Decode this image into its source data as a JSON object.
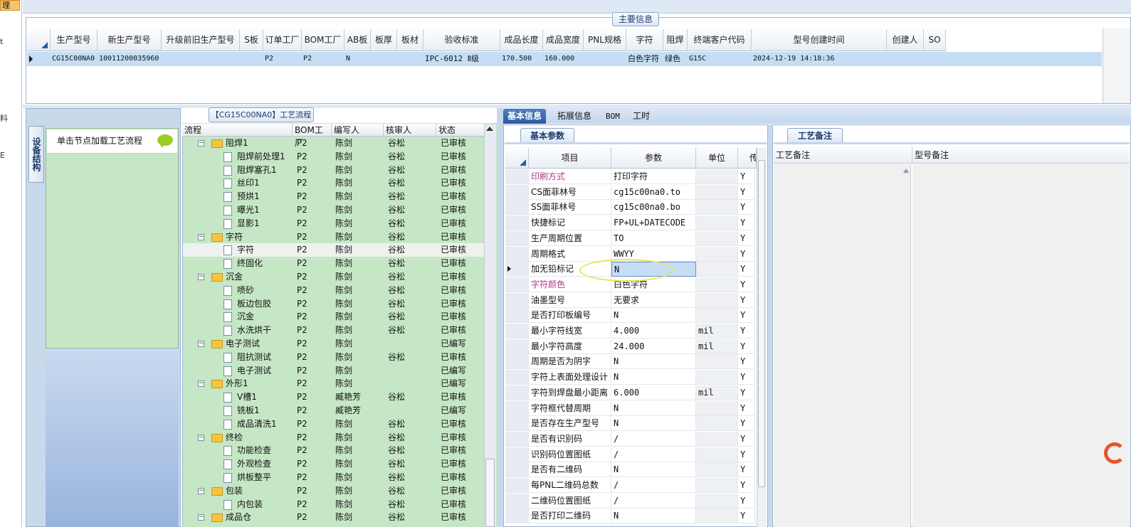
{
  "left_strip": {
    "selected": "理",
    "chars": [
      "t",
      "料",
      "E"
    ]
  },
  "main": {
    "title": "主要信息",
    "columns": [
      "生产型号",
      "新生产型号",
      "升级前旧生产型号",
      "S板",
      "订单工厂",
      "BOM工厂",
      "AB板",
      "板厚",
      "板材",
      "验收标准",
      "成品长度",
      "成品宽度",
      "PNL规格",
      "字符",
      "阻焊",
      "终端客户代码",
      "型号创建时间",
      "创建人",
      "SO"
    ],
    "row": [
      "CG15C00NA0",
      "10011200035960",
      "",
      "",
      "P2",
      "P2",
      "N",
      "",
      "",
      "IPC-6012 Ⅱ级",
      "170.500",
      "160.000",
      "",
      "白色字符",
      "绿色",
      "G15C",
      "2024-12-19 14:18:36",
      "",
      ""
    ]
  },
  "process": {
    "title": "【CG15C00NA0】工艺流程",
    "side_tab": "设备结构",
    "hint": "单击节点加载工艺流程",
    "columns": [
      "流程",
      "BOM工厂",
      "编写人",
      "核审人",
      "状态"
    ],
    "rows": [
      {
        "name": "阻焊1",
        "level": 0,
        "bom": "P2",
        "writer": "陈剑",
        "reviewer": "谷松",
        "status": "已审核"
      },
      {
        "name": "阻焊前处理1",
        "level": 1,
        "bom": "P2",
        "writer": "陈剑",
        "reviewer": "谷松",
        "status": "已审核"
      },
      {
        "name": "阻焊塞孔1",
        "level": 1,
        "bom": "P2",
        "writer": "陈剑",
        "reviewer": "谷松",
        "status": "已审核"
      },
      {
        "name": "丝印1",
        "level": 1,
        "bom": "P2",
        "writer": "陈剑",
        "reviewer": "谷松",
        "status": "已审核"
      },
      {
        "name": "预烘1",
        "level": 1,
        "bom": "P2",
        "writer": "陈剑",
        "reviewer": "谷松",
        "status": "已审核"
      },
      {
        "name": "曝光1",
        "level": 1,
        "bom": "P2",
        "writer": "陈剑",
        "reviewer": "谷松",
        "status": "已审核"
      },
      {
        "name": "显影1",
        "level": 1,
        "bom": "P2",
        "writer": "陈剑",
        "reviewer": "谷松",
        "status": "已审核"
      },
      {
        "name": "字符",
        "level": 0,
        "bom": "P2",
        "writer": "陈剑",
        "reviewer": "谷松",
        "status": "已审核"
      },
      {
        "name": "字符",
        "level": 1,
        "bom": "P2",
        "writer": "陈剑",
        "reviewer": "谷松",
        "status": "已审核",
        "highlight": true
      },
      {
        "name": "终固化",
        "level": 1,
        "bom": "P2",
        "writer": "陈剑",
        "reviewer": "谷松",
        "status": "已审核"
      },
      {
        "name": "沉金",
        "level": 0,
        "bom": "P2",
        "writer": "陈剑",
        "reviewer": "谷松",
        "status": "已审核"
      },
      {
        "name": "喷砂",
        "level": 1,
        "bom": "P2",
        "writer": "陈剑",
        "reviewer": "谷松",
        "status": "已审核"
      },
      {
        "name": "板边包胶",
        "level": 1,
        "bom": "P2",
        "writer": "陈剑",
        "reviewer": "谷松",
        "status": "已审核"
      },
      {
        "name": "沉金",
        "level": 1,
        "bom": "P2",
        "writer": "陈剑",
        "reviewer": "谷松",
        "status": "已审核"
      },
      {
        "name": "水洗烘干",
        "level": 1,
        "bom": "P2",
        "writer": "陈剑",
        "reviewer": "谷松",
        "status": "已审核"
      },
      {
        "name": "电子测试",
        "level": 0,
        "bom": "P2",
        "writer": "陈剑",
        "reviewer": "",
        "status": "已编写"
      },
      {
        "name": "阻抗测试",
        "level": 1,
        "bom": "P2",
        "writer": "陈剑",
        "reviewer": "谷松",
        "status": "已审核"
      },
      {
        "name": "电子测试",
        "level": 1,
        "bom": "P2",
        "writer": "陈剑",
        "reviewer": "",
        "status": "已编写"
      },
      {
        "name": "外形1",
        "level": 0,
        "bom": "P2",
        "writer": "陈剑",
        "reviewer": "",
        "status": "已编写"
      },
      {
        "name": "V槽1",
        "level": 1,
        "bom": "P2",
        "writer": "臧艳芳",
        "reviewer": "谷松",
        "status": "已审核"
      },
      {
        "name": "铣板1",
        "level": 1,
        "bom": "P2",
        "writer": "臧艳芳",
        "reviewer": "",
        "status": "已编写"
      },
      {
        "name": "成品清洗1",
        "level": 1,
        "bom": "P2",
        "writer": "陈剑",
        "reviewer": "谷松",
        "status": "已审核"
      },
      {
        "name": "终检",
        "level": 0,
        "bom": "P2",
        "writer": "陈剑",
        "reviewer": "谷松",
        "status": "已审核"
      },
      {
        "name": "功能检查",
        "level": 1,
        "bom": "P2",
        "writer": "陈剑",
        "reviewer": "谷松",
        "status": "已审核"
      },
      {
        "name": "外观检查",
        "level": 1,
        "bom": "P2",
        "writer": "陈剑",
        "reviewer": "谷松",
        "status": "已审核"
      },
      {
        "name": "烘板整平",
        "level": 1,
        "bom": "P2",
        "writer": "陈剑",
        "reviewer": "谷松",
        "status": "已审核"
      },
      {
        "name": "包装",
        "level": 0,
        "bom": "P2",
        "writer": "陈剑",
        "reviewer": "谷松",
        "status": "已审核"
      },
      {
        "name": "内包装",
        "level": 1,
        "bom": "P2",
        "writer": "陈剑",
        "reviewer": "谷松",
        "status": "已审核"
      },
      {
        "name": "成品仓",
        "level": 0,
        "bom": "P2",
        "writer": "陈剑",
        "reviewer": "谷松",
        "status": "已审核"
      }
    ]
  },
  "right_tabs": [
    "基本信息",
    "拓展信息",
    "BOM",
    "工时"
  ],
  "basic": {
    "title": "基本参数",
    "columns": [
      "项目",
      "参数",
      "单位",
      "传"
    ],
    "rows": [
      {
        "item": "印刷方式",
        "param": "打印字符",
        "unit": "",
        "flag": "Y",
        "pink": true
      },
      {
        "item": "CS面菲林号",
        "param": "cg15c00na0.to",
        "unit": "",
        "flag": "Y"
      },
      {
        "item": "SS面菲林号",
        "param": "cg15c00na0.bo",
        "unit": "",
        "flag": "Y"
      },
      {
        "item": "快捷标记",
        "param": "FP+UL+DATECODE",
        "unit": "",
        "flag": "Y"
      },
      {
        "item": "生产周期位置",
        "param": "TO",
        "unit": "",
        "flag": "Y"
      },
      {
        "item": "周期格式",
        "param": "WWYY",
        "unit": "",
        "flag": "Y"
      },
      {
        "item": "加无铅标记",
        "param": "N",
        "unit": "",
        "flag": "Y",
        "current": true
      },
      {
        "item": "字符颜色",
        "param": "白色字符",
        "unit": "",
        "flag": "Y",
        "pink": true
      },
      {
        "item": "油墨型号",
        "param": "无要求",
        "unit": "",
        "flag": "Y"
      },
      {
        "item": "是否打印板编号",
        "param": "N",
        "unit": "",
        "flag": "Y"
      },
      {
        "item": "最小字符线宽",
        "param": "4.000",
        "unit": "mil",
        "flag": "Y"
      },
      {
        "item": "最小字符高度",
        "param": "24.000",
        "unit": "mil",
        "flag": "Y"
      },
      {
        "item": "周期是否为阴字",
        "param": "N",
        "unit": "",
        "flag": "Y"
      },
      {
        "item": "字符上表面处理设计",
        "param": "N",
        "unit": "",
        "flag": "Y"
      },
      {
        "item": "字符到焊盘最小距离",
        "param": "6.000",
        "unit": "mil",
        "flag": "Y"
      },
      {
        "item": "字符框代替周期",
        "param": "N",
        "unit": "",
        "flag": "Y"
      },
      {
        "item": "是否存在生产型号",
        "param": "N",
        "unit": "",
        "flag": "Y"
      },
      {
        "item": "是否有识别码",
        "param": "/",
        "unit": "",
        "flag": "Y"
      },
      {
        "item": "识别码位置图纸",
        "param": "/",
        "unit": "",
        "flag": "Y"
      },
      {
        "item": "是否有二维码",
        "param": "N",
        "unit": "",
        "flag": "Y"
      },
      {
        "item": "每PNL二维码总数",
        "param": "/",
        "unit": "",
        "flag": "Y"
      },
      {
        "item": "二维码位置图纸",
        "param": "/",
        "unit": "",
        "flag": "Y"
      },
      {
        "item": "是否打印二维码",
        "param": "N",
        "unit": "",
        "flag": "Y"
      }
    ]
  },
  "notes": {
    "title": "工艺备注",
    "columns": [
      "工艺备注",
      "型号备注"
    ]
  },
  "colors": {
    "header_blue": "#1d3a6a",
    "row_selected": "#c5def6",
    "tree_bg": "#c5e7c5",
    "tab_active": "#2c5a9b",
    "pink": "#b03a8a",
    "folder": "#f4c542"
  }
}
